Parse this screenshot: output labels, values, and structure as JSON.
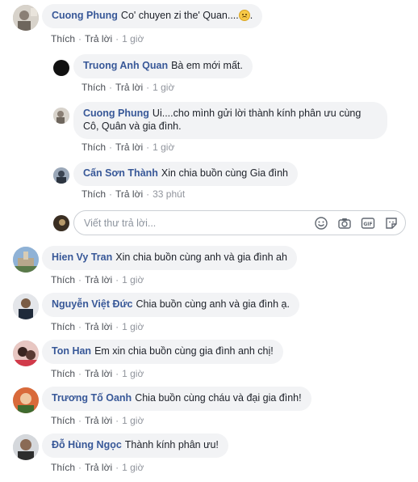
{
  "actions": {
    "like": "Thích",
    "reply": "Trả lời",
    "separator": "·"
  },
  "comments": [
    {
      "author": "Cuong Phung",
      "text": "Co' chuyen zi the' Quan....",
      "trailing": ".",
      "time": "1 giờ"
    },
    {
      "author": "Truong Anh Quan",
      "text": "Bà em mới mất.",
      "time": "1 giờ"
    },
    {
      "author": "Cuong Phung",
      "text": "Ui....cho mình gửi lời thành kính phân ưu cùng Cô, Quân và gia đình.",
      "time": "1 giờ"
    },
    {
      "author": "Cấn Sơn Thành",
      "text": "Xin chia buồn cùng Gia đình",
      "time": "33 phút"
    },
    {
      "author": "Hien Vy Tran",
      "text": "Xin chia buồn cùng anh và gia đình ah",
      "time": "1 giờ"
    },
    {
      "author": "Nguyễn Việt Đức",
      "text": "Chia buồn cùng anh và gia đình ạ.",
      "time": "1 giờ"
    },
    {
      "author": "Ton Han",
      "text": "Em xin chia buồn cùng gia đình anh chị!",
      "time": "1 giờ"
    },
    {
      "author": "Trương Tố Oanh",
      "text": "Chia buồn cùng cháu và đại gia đình!",
      "time": "1 giờ"
    },
    {
      "author": "Đỗ Hùng Ngọc",
      "text": "Thành kính phân ưu!",
      "time": "1 giờ"
    }
  ],
  "reply_box": {
    "placeholder": "Viết thư trả lời...",
    "icons": [
      "emoji-icon",
      "camera-icon",
      "gif-icon",
      "sticker-icon"
    ]
  },
  "colors": {
    "author": "#385898",
    "bubble": "#f2f3f5",
    "action": "#4b4f56",
    "time": "#90949c"
  }
}
